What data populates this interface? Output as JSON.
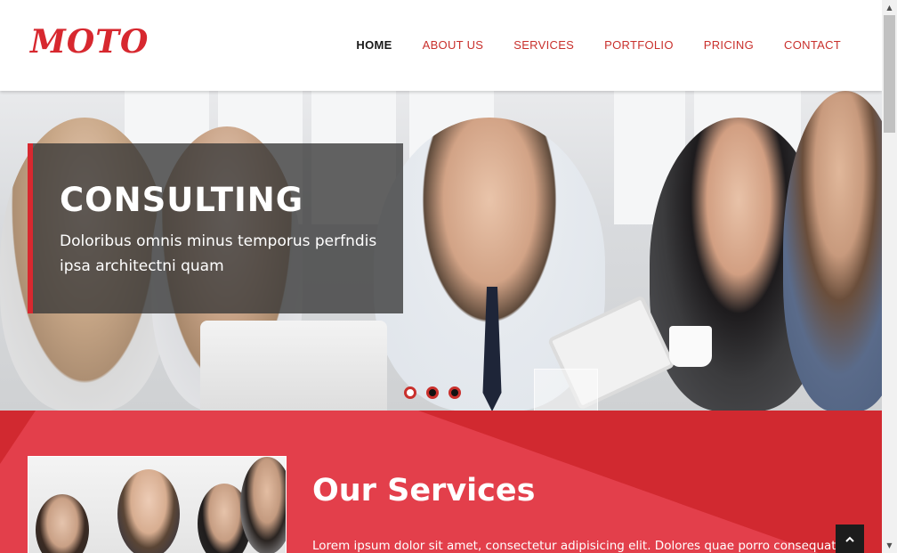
{
  "header": {
    "logo": "MOTO",
    "nav": [
      {
        "label": "HOME",
        "active": true
      },
      {
        "label": "ABOUT US",
        "active": false
      },
      {
        "label": "SERVICES",
        "active": false
      },
      {
        "label": "PORTFOLIO",
        "active": false
      },
      {
        "label": "PRICING",
        "active": false
      },
      {
        "label": "CONTACT",
        "active": false
      }
    ]
  },
  "hero": {
    "title": "CONSULTING",
    "subtitle": "Doloribus omnis minus temporus perfndis ipsa architectni quam",
    "slides": 3,
    "active_slide": 1
  },
  "services": {
    "title": "Our Services",
    "text": "Lorem ipsum dolor sit amet, consectetur adipisicing elit. Dolores quae porro consequatur"
  },
  "icons": {
    "back_to_top": "chevron-up-icon",
    "scroll_up": "triangle-up-icon",
    "scroll_down": "triangle-down-icon"
  },
  "colors": {
    "accent": "#d7282f",
    "services_bg": "#e33f4b",
    "services_dark": "#d12930"
  }
}
